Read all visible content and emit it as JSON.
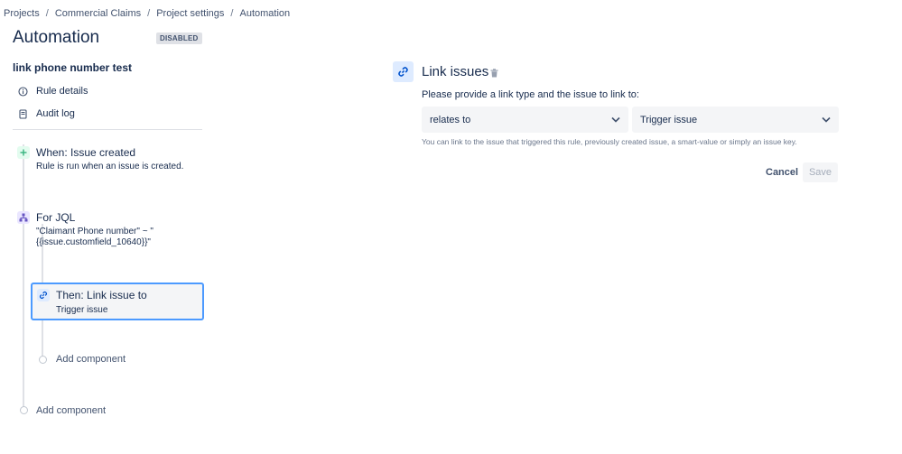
{
  "breadcrumb": {
    "items": [
      "Projects",
      "Commercial Claims",
      "Project settings",
      "Automation"
    ],
    "separator": "/"
  },
  "header": {
    "title": "Automation",
    "status_badge": "DISABLED"
  },
  "rule": {
    "name": "link phone number test",
    "links": [
      {
        "label": "Rule details",
        "icon": "info-icon"
      },
      {
        "label": "Audit log",
        "icon": "document-icon"
      }
    ]
  },
  "flow": {
    "trigger": {
      "title": "When: Issue created",
      "subtitle": "Rule is run when an issue is created.",
      "icon": "plus-icon",
      "icon_color": "#36b37e"
    },
    "branch": {
      "title": "For JQL",
      "subtitle_line1": "\"Claimant Phone number\" ~ \"",
      "subtitle_line2": "{{issue.customfield_10640}}\"",
      "icon": "branch-icon",
      "icon_color": "#6554c0"
    },
    "action": {
      "title": "Then: Link issue to",
      "subtitle": "Trigger issue",
      "icon": "link-icon",
      "icon_color": "#0052cc"
    },
    "add_component_inner": "Add component",
    "add_component_outer": "Add component"
  },
  "panel": {
    "title": "Link issues",
    "icon": "link-icon",
    "label": "Please provide a link type and the issue to link to:",
    "link_type": {
      "value": "relates to"
    },
    "target_issue": {
      "value": "Trigger issue"
    },
    "helper": "You can link to the issue that triggered this rule, previously created issue, a smart-value or simply an issue key.",
    "cancel_label": "Cancel",
    "save_label": "Save"
  },
  "colors": {
    "accent": "#4c9aff",
    "text": "#172b4d",
    "muted": "#6b778c"
  }
}
